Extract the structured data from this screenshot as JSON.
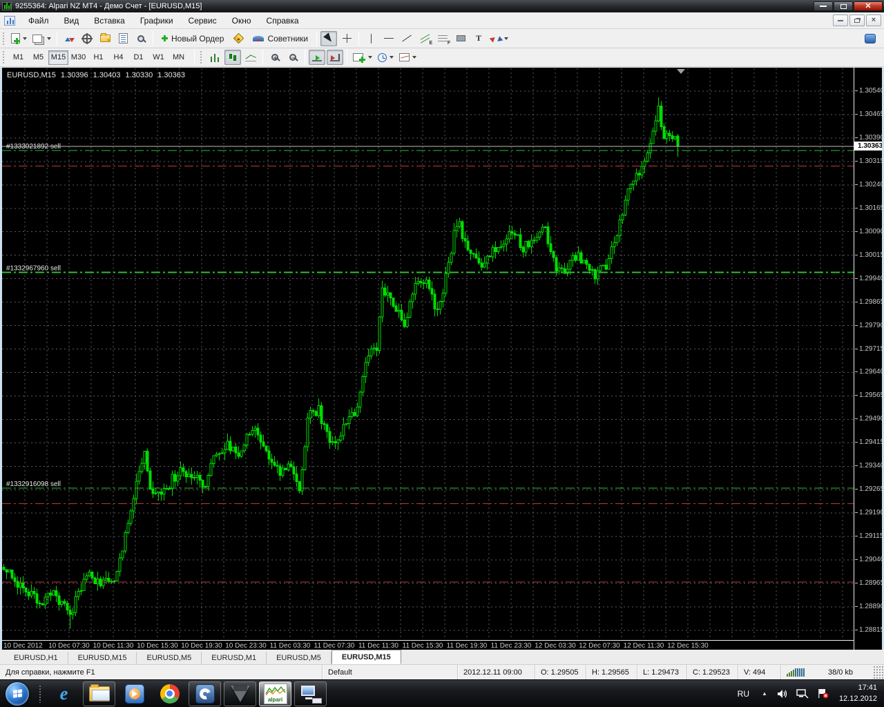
{
  "window": {
    "title": "9255364: Alpari NZ MT4 - Демо Счет - [EURUSD,M15]"
  },
  "menu": {
    "items": [
      "Файл",
      "Вид",
      "Вставка",
      "Графики",
      "Сервис",
      "Окно",
      "Справка"
    ]
  },
  "toolbar": {
    "new_order": "Новый Ордер",
    "experts": "Советники",
    "glyphs": {
      "channel": "E",
      "fibo": "F",
      "text": "T"
    },
    "timeframes": [
      "M1",
      "M5",
      "M15",
      "M30",
      "H1",
      "H4",
      "D1",
      "W1",
      "MN"
    ],
    "active_timeframe": "M15"
  },
  "chart": {
    "symbol_label": "EURUSD,M15",
    "quote_open": "1.30396",
    "quote_high": "1.30403",
    "quote_low": "1.30330",
    "quote_close": "1.30363",
    "bid_tag": "1.30363"
  },
  "chart_data": {
    "type": "candlestick",
    "title": "EURUSD,M15",
    "price_max": 1.3054,
    "price_min": 1.28815,
    "price_step": 0.00075,
    "price_labels": [
      "1.30540",
      "1.30465",
      "1.30390",
      "1.30315",
      "1.30240",
      "1.30165",
      "1.30090",
      "1.30015",
      "1.29940",
      "1.29865",
      "1.29790",
      "1.29715",
      "1.29640",
      "1.29565",
      "1.29490",
      "1.29415",
      "1.29340",
      "1.29265",
      "1.29190",
      "1.29115",
      "1.29040",
      "1.28965",
      "1.28890",
      "1.28815"
    ],
    "time_labels": [
      "10 Dec 2012",
      "10 Dec 07:30",
      "10 Dec 11:30",
      "10 Dec 15:30",
      "10 Dec 19:30",
      "10 Dec 23:30",
      "11 Dec 03:30",
      "11 Dec 07:30",
      "11 Dec 11:30",
      "11 Dec 15:30",
      "11 Dec 19:30",
      "11 Dec 23:30",
      "12 Dec 03:30",
      "12 Dec 07:30",
      "12 Dec 11:30",
      "12 Dec 15:30"
    ],
    "bars_per_label": 16,
    "bar_count": 245,
    "price_path_anchors": [
      [
        0,
        1.2902
      ],
      [
        4,
        1.2897
      ],
      [
        9,
        1.2893
      ],
      [
        13,
        1.289
      ],
      [
        17,
        1.2894
      ],
      [
        21,
        1.289
      ],
      [
        24,
        1.2885
      ],
      [
        27,
        1.2894
      ],
      [
        31,
        1.2899
      ],
      [
        35,
        1.2897
      ],
      [
        39,
        1.2896
      ],
      [
        43,
        1.2907
      ],
      [
        47,
        1.2925
      ],
      [
        51,
        1.2938
      ],
      [
        53,
        1.2928
      ],
      [
        57,
        1.2924
      ],
      [
        61,
        1.293
      ],
      [
        65,
        1.2933
      ],
      [
        69,
        1.293
      ],
      [
        73,
        1.2928
      ],
      [
        77,
        1.2939
      ],
      [
        81,
        1.2941
      ],
      [
        85,
        1.2938
      ],
      [
        89,
        1.2944
      ],
      [
        92,
        1.2945
      ],
      [
        96,
        1.2937
      ],
      [
        100,
        1.2932
      ],
      [
        104,
        1.2934
      ],
      [
        107,
        1.2926
      ],
      [
        110,
        1.295
      ],
      [
        114,
        1.2952
      ],
      [
        117,
        1.2944
      ],
      [
        120,
        1.2941
      ],
      [
        124,
        1.2948
      ],
      [
        128,
        1.2952
      ],
      [
        131,
        1.2968
      ],
      [
        135,
        1.2972
      ],
      [
        137,
        1.2992
      ],
      [
        141,
        1.2985
      ],
      [
        145,
        1.298
      ],
      [
        149,
        1.2992
      ],
      [
        153,
        1.2995
      ],
      [
        156,
        1.2984
      ],
      [
        159,
        1.299
      ],
      [
        163,
        1.3008
      ],
      [
        165,
        1.3011
      ],
      [
        169,
        1.3001
      ],
      [
        173,
        1.2999
      ],
      [
        177,
        1.3003
      ],
      [
        181,
        1.3006
      ],
      [
        184,
        1.301
      ],
      [
        188,
        1.3004
      ],
      [
        192,
        1.3008
      ],
      [
        196,
        1.3009
      ],
      [
        200,
        1.2998
      ],
      [
        203,
        1.2997
      ],
      [
        207,
        1.3001
      ],
      [
        211,
        1.3
      ],
      [
        214,
        1.2995
      ],
      [
        218,
        1.2998
      ],
      [
        222,
        1.3008
      ],
      [
        226,
        1.3022
      ],
      [
        229,
        1.3027
      ],
      [
        232,
        1.3031
      ],
      [
        235,
        1.304
      ],
      [
        237,
        1.3048
      ],
      [
        239,
        1.304
      ],
      [
        241,
        1.3041
      ],
      [
        243,
        1.3039
      ],
      [
        244,
        1.30363
      ]
    ],
    "wick_extremes": [
      [
        237,
        1.3052,
        "high"
      ],
      [
        24,
        1.2882,
        "low"
      ]
    ],
    "last_bar": {
      "open": 1.30396,
      "high": 1.30403,
      "low": 1.3033,
      "close": 1.30363
    },
    "bid": 1.30363,
    "orders": [
      {
        "label": "#1333021892 sell",
        "price": 1.3035,
        "thick": false
      },
      {
        "label": "#1332967960 sell",
        "price": 1.2996,
        "thick": true
      },
      {
        "label": "#1332916098 sell",
        "price": 1.2927,
        "thick": false
      }
    ],
    "stop_levels": [
      1.303,
      1.2922,
      1.2897
    ],
    "colors": {
      "bg": "#000000",
      "grid": "#5c5c64",
      "candle": "#00dd00",
      "order": "#2fbf2f",
      "stop": "#c03a3a",
      "bid": "#bfbfbf"
    }
  },
  "tabs": {
    "items": [
      "EURUSD,H1",
      "EURUSD,M15",
      "EURUSD,M5",
      "EURUSD,M1",
      "EURUSD,M5",
      "EURUSD,M15"
    ],
    "active_index": 5
  },
  "statusbar": {
    "help": "Для справки, нажмите F1",
    "profile": "Default",
    "bar_time": "2012.12.11 09:00",
    "open": "O: 1.29505",
    "high": "H: 1.29565",
    "low": "L: 1.29473",
    "close": "C: 1.29523",
    "volume": "V: 494",
    "traffic": "38/0 kb"
  },
  "taskbar": {
    "language": "RU",
    "clock_time": "17:41",
    "clock_date": "12.12.2012",
    "alpari_label": "alpari"
  }
}
